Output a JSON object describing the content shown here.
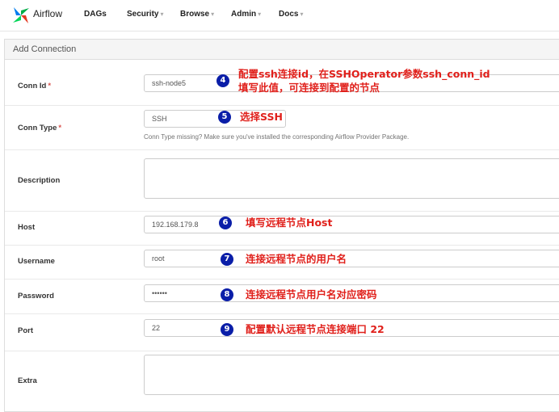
{
  "navbar": {
    "brand": "Airflow",
    "items": [
      {
        "label": "DAGs",
        "caret": ""
      },
      {
        "label": "Security",
        "caret": "▾"
      },
      {
        "label": "Browse",
        "caret": "▾"
      },
      {
        "label": "Admin",
        "caret": "▾"
      },
      {
        "label": "Docs",
        "caret": "▾"
      }
    ]
  },
  "panel": {
    "title": "Add Connection"
  },
  "form": {
    "conn_id": {
      "label": "Conn Id",
      "required": "*",
      "value": "ssh-node5"
    },
    "conn_type": {
      "label": "Conn Type",
      "required": "*",
      "value": "SSH",
      "help": "Conn Type missing? Make sure you've installed the corresponding Airflow Provider Package."
    },
    "description": {
      "label": "Description",
      "value": ""
    },
    "host": {
      "label": "Host",
      "value": "192.168.179.8"
    },
    "username": {
      "label": "Username",
      "value": "root"
    },
    "password": {
      "label": "Password",
      "value": "••••••"
    },
    "port": {
      "label": "Port",
      "value": "22"
    },
    "extra": {
      "label": "Extra",
      "value": ""
    }
  },
  "annotations": [
    {
      "num": "4",
      "line1": "配置ssh连接id，在SSHOperator参数ssh_conn_id",
      "line2": "填写此值，可连接到配置的节点"
    },
    {
      "num": "5",
      "line1": "选择SSH"
    },
    {
      "num": "6",
      "line1": "填写远程节点Host"
    },
    {
      "num": "7",
      "line1": "连接远程节点的用户名"
    },
    {
      "num": "8",
      "line1": "连接远程节点用户名对应密码"
    },
    {
      "num": "9",
      "line1": "配置默认远程节点连接端口 22"
    }
  ],
  "colors": {
    "annotation_text": "#e0201b",
    "badge_bg": "#0a1ea8",
    "required": "#d9534f"
  }
}
